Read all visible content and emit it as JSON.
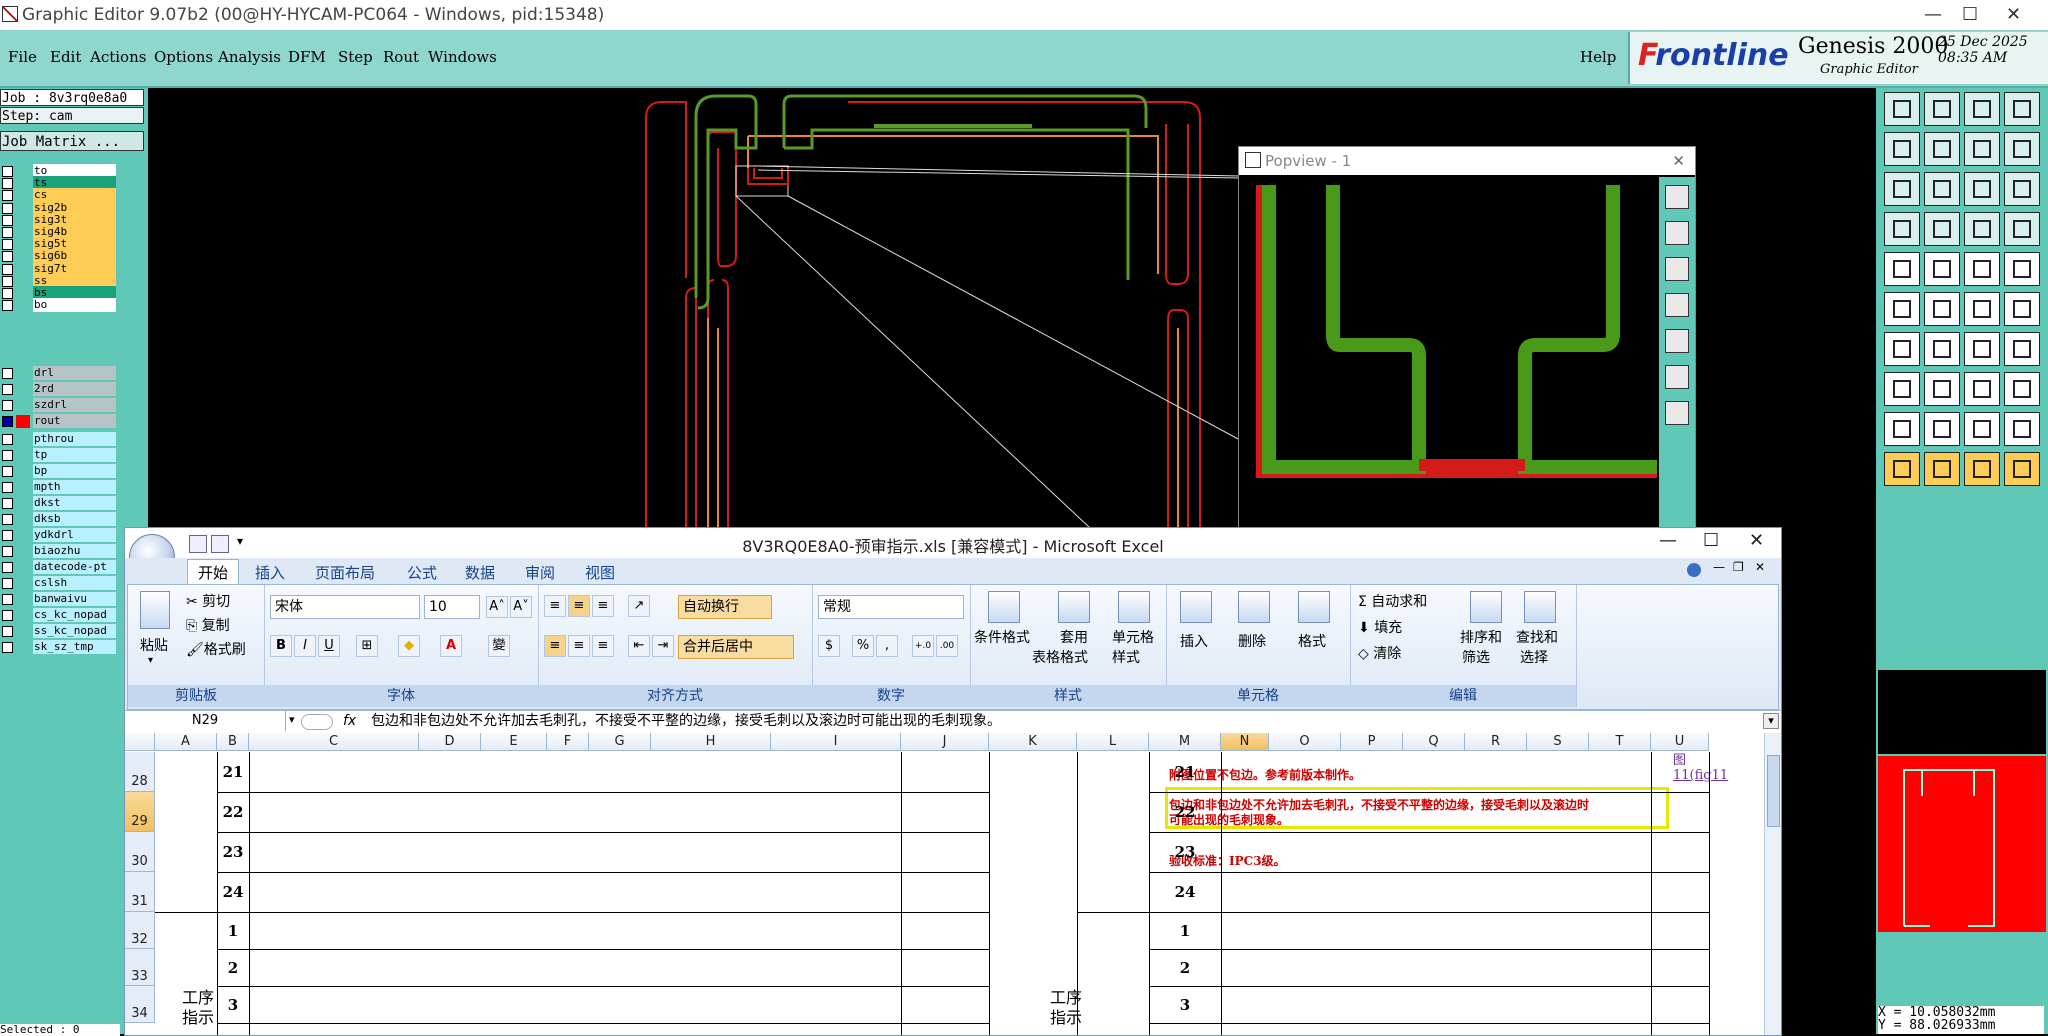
{
  "genesis": {
    "title": "Graphic Editor 9.07b2 (00@HY-HYCAM-PC064 - Windows, pid:15348)",
    "menu": [
      "File",
      "Edit",
      "Actions",
      "Options",
      "Analysis",
      "DFM",
      "Step",
      "Rout",
      "Windows"
    ],
    "help": "Help",
    "logo": "Frontline",
    "product": "Genesis 2000",
    "product_sub": "Graphic Editor",
    "date": "25 Dec 2025",
    "time": "08:35 AM",
    "job": "Job : 8v3rq0e8a0",
    "step": "Step: cam",
    "job_matrix": "Job Matrix ...",
    "layers_board": [
      {
        "name": "to",
        "color": "#ffffff"
      },
      {
        "name": "ts",
        "color": "#1aa37a"
      },
      {
        "name": "cs",
        "color": "#ffcc55"
      },
      {
        "name": "sig2b",
        "color": "#ffcc55"
      },
      {
        "name": "sig3t",
        "color": "#ffcc55"
      },
      {
        "name": "sig4b",
        "color": "#ffcc55"
      },
      {
        "name": "sig5t",
        "color": "#ffcc55"
      },
      {
        "name": "sig6b",
        "color": "#ffcc55"
      },
      {
        "name": "sig7t",
        "color": "#ffcc55"
      },
      {
        "name": "ss",
        "color": "#ffcc55"
      },
      {
        "name": "bs",
        "color": "#1aa37a"
      },
      {
        "name": "bo",
        "color": "#ffffff"
      }
    ],
    "layers_drill": [
      {
        "name": "drl",
        "color": "#b6c4c8"
      },
      {
        "name": "2rd",
        "color": "#b6c4c8"
      },
      {
        "name": "szdrl",
        "color": "#b6c4c8"
      },
      {
        "name": "rout",
        "color": "#b6c4c8"
      }
    ],
    "layers_misc": [
      "pthrou",
      "tp",
      "bp",
      "mpth",
      "dkst",
      "dksb",
      "ydkdrl",
      "biaozhu",
      "datecode-pt",
      "cslsh",
      "banwaivu",
      "cs_kc_nopad",
      "ss_kc_nopad",
      "sk_sz_tmp"
    ],
    "selected": "Selected : 0",
    "popview_title": "Popview - 1",
    "coord_x": "X = 10.058032mm",
    "coord_y": "Y = 88.026933mm"
  },
  "excel": {
    "title": "8V3RQ0E8A0-预审指示.xls  [兼容模式] - Microsoft Excel",
    "tabs": [
      "开始",
      "插入",
      "页面布局",
      "公式",
      "数据",
      "审阅",
      "视图"
    ],
    "clipboard": {
      "paste": "粘贴",
      "cut": "剪切",
      "copy": "复制",
      "painter": "格式刷",
      "label": "剪贴板"
    },
    "font": {
      "name": "宋体",
      "size": "10",
      "label": "字体",
      "bold": "B",
      "italic": "I",
      "underline": "U",
      "grow": "A˄",
      "shrink": "A˅",
      "phonetic": "變"
    },
    "align": {
      "wrap": "自动换行",
      "merge": "合并后居中",
      "label": "对齐方式"
    },
    "number": {
      "format": "常规",
      "label": "数字",
      "percent": "%",
      "comma": ","
    },
    "styles": {
      "cond": "条件格式",
      "table1": "套用",
      "table2": "表格格式",
      "cell1": "单元格",
      "cell2": "样式",
      "label": "样式"
    },
    "cells": {
      "insert": "插入",
      "delete": "删除",
      "format": "格式",
      "label": "单元格"
    },
    "editing": {
      "autosum": "自动求和",
      "fill": "填充",
      "clear": "清除",
      "sort1": "排序和",
      "sort2": "筛选",
      "find1": "查找和",
      "find2": "选择",
      "label": "编辑"
    },
    "name_box": "N29",
    "fx": "fx",
    "formula": "包边和非包边处不允许加去毛刺孔，不接受不平整的边缘，接受毛刺以及滚边时可能出现的毛刺现象。",
    "columns": [
      "A",
      "B",
      "C",
      "D",
      "E",
      "F",
      "G",
      "H",
      "I",
      "J",
      "K",
      "L",
      "M",
      "N",
      "O",
      "P",
      "Q",
      "R",
      "S",
      "T",
      "U"
    ],
    "rows": [
      "28",
      "29",
      "30",
      "31",
      "32",
      "33",
      "34"
    ],
    "left_nums": [
      "21",
      "22",
      "23",
      "24",
      "1",
      "2",
      "3"
    ],
    "right_nums": [
      "21",
      "22",
      "23",
      "24",
      "1",
      "2",
      "3"
    ],
    "notes": {
      "r28": "附图位置不包边。参考前版本制作。",
      "r29a": "包边和非包边处不允许加去毛刺孔，不接受不平整的边缘，接受毛刺以及滚边时",
      "r29b": "可能出现的毛刺现象。",
      "r30": "验收标准：IPC3级。"
    },
    "u28a": "图",
    "u28b": "11(fig11",
    "proc_left1": "工序",
    "proc_left2": "指示",
    "proc_right1": "工序",
    "proc_right2": "指示"
  }
}
